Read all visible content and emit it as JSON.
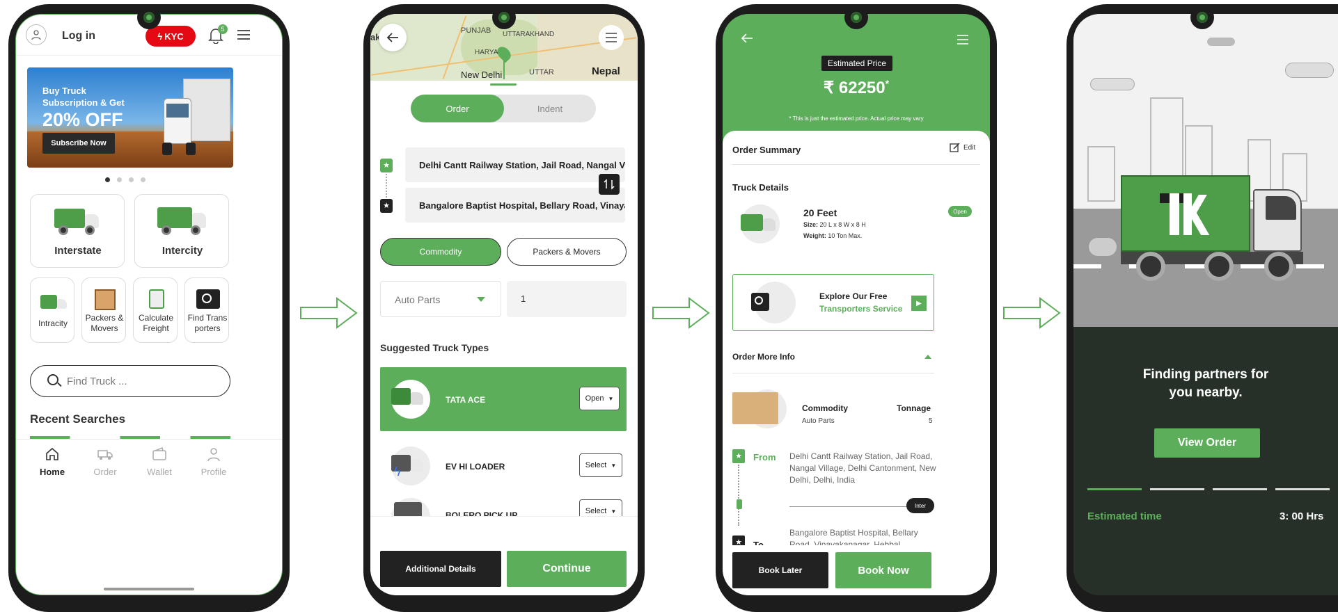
{
  "brand": {
    "green": "#5cae5a",
    "dark": "#263029",
    "red": "#e50914"
  },
  "screen1": {
    "login": "Log in",
    "kyc": "KYC",
    "notif_count": "5",
    "banner": {
      "line1": "Buy Truck",
      "line2": "Subscription & Get",
      "offer": "20% OFF",
      "cta": "Subscribe Now"
    },
    "cards": {
      "interstate": "Interstate",
      "intercity": "Intercity"
    },
    "tiles": [
      {
        "line1": "Intracity",
        "line2": ""
      },
      {
        "line1": "Packers &",
        "line2": "Movers"
      },
      {
        "line1": "Calculate",
        "line2": "Freight"
      },
      {
        "line1": "Find Trans",
        "line2": "porters"
      }
    ],
    "search_placeholder": "Find Truck ...",
    "recent": "Recent Searches",
    "nav": [
      "Home",
      "Order",
      "Wallet",
      "Profile"
    ]
  },
  "screen2": {
    "map": {
      "punjab": "PUNJAB",
      "uttarakhand": "UTTARAKHAND",
      "haryana": "HARYA",
      "delhi": "New Delhi",
      "uttar": "UTTAR",
      "nepal": "Nepal",
      "edge": "ak"
    },
    "tabs": [
      "Order",
      "Indent"
    ],
    "pickup": "Delhi Cantt Railway Station, Jail Road, Nangal Vi",
    "drop": "Bangalore Baptist Hospital, Bellary Road, Vinaya",
    "types": [
      "Commodity",
      "Packers & Movers"
    ],
    "commodity": "Auto Parts",
    "quantity": "1",
    "suggested": "Suggested Truck Types",
    "trucks": [
      {
        "name": "TATA ACE",
        "action": "Open"
      },
      {
        "name": "EV HI LOADER",
        "action": "Select"
      },
      {
        "name": "BOLERO PICK UP",
        "action": "Select"
      }
    ],
    "additional": "Additional Details",
    "continue": "Continue"
  },
  "screen3": {
    "estimated_label": "Estimated Price",
    "currency": "₹",
    "price": "62250",
    "asterisk": "*",
    "note": "This is just the estimated price. Actual price may vary",
    "order_summary": "Order Summary",
    "edit": "Edit",
    "truck_details": "Truck Details",
    "truck_name": "20 Feet",
    "truck_badge": "Open",
    "size_label": "Size:",
    "size_value": "20 L x 8 W x 8 H",
    "weight_label": "Weight:",
    "weight_value": "10 Ton Max.",
    "explore_line1": "Explore Our Free",
    "explore_line2": "Transporters Service",
    "order_more_info": "Order More Info",
    "commodity_label": "Commodity",
    "commodity_value": "Auto Parts",
    "tonnage_label": "Tonnage",
    "tonnage_value": "5",
    "from_label": "From",
    "from_address": "Delhi Cantt Railway Station, Jail Road, Nangal Village, Delhi Cantonment, New Delhi, Delhi, India",
    "inter_badge": "Inter",
    "to_label": "To",
    "to_address": "Bangalore Baptist Hospital, Bellary Road, Vinayakanagar, Hebbal, Bengaluru, Karnataka",
    "book_later": "Book Later",
    "book_now": "Book Now"
  },
  "screen4": {
    "finding_line1": "Finding partners for",
    "finding_line2": "you nearby.",
    "view_order": "View Order",
    "estimated_time_label": "Estimated time",
    "estimated_time_value": "3: 00 Hrs",
    "progress_segments_filled": 1,
    "progress_segments_total": 4
  }
}
